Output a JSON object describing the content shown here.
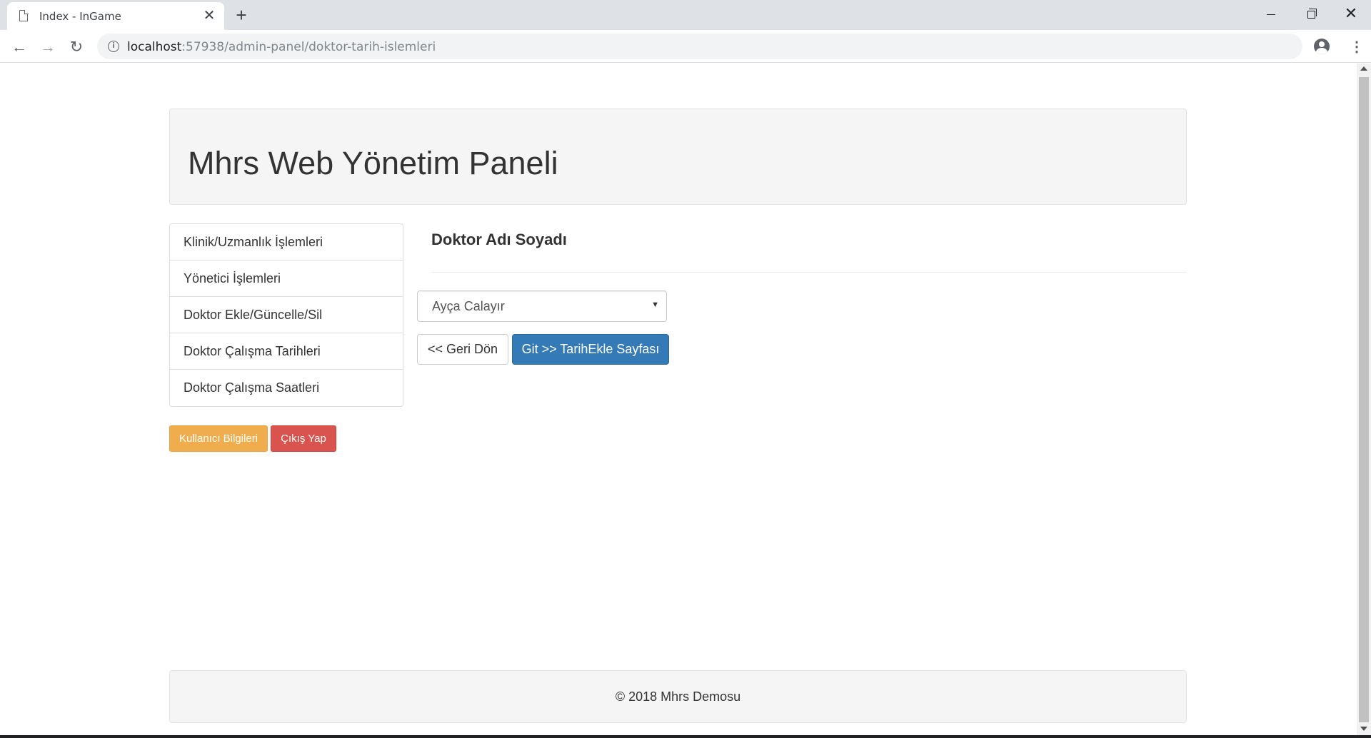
{
  "browser": {
    "tab_title": "Index - InGame",
    "tab_close": "✕",
    "new_tab": "+",
    "url_host": "localhost",
    "url_path": ":57938/admin-panel/doktor-tarih-islemleri",
    "info_glyph": "i",
    "icons": [
      "doc-icon",
      "close-icon",
      "plus-icon",
      "back-icon",
      "forward-icon",
      "reload-icon",
      "info-icon",
      "star-icon",
      "account-icon",
      "menu-icon"
    ]
  },
  "header": {
    "title": "Mhrs Web Yönetim Paneli"
  },
  "sidebar": {
    "items": [
      {
        "label": "Klinik/Uzmanlık İşlemleri"
      },
      {
        "label": "Yönetici İşlemleri"
      },
      {
        "label": "Doktor Ekle/Güncelle/Sil"
      },
      {
        "label": "Doktor Çalışma Tarihleri"
      },
      {
        "label": "Doktor Çalışma Saatleri"
      }
    ],
    "user_info_button": "Kullanıcı Bilgileri",
    "logout_button": "Çıkış Yap"
  },
  "main": {
    "section_title": "Doktor Adı Soyadı",
    "doctor_select_value": "Ayça Calayır",
    "back_button": "<< Geri Dön",
    "go_button": "Git >> TarihEkle Sayfası"
  },
  "footer": {
    "text": "© 2018 Mhrs Demosu"
  },
  "colors": {
    "primary": "#337ab7",
    "warning": "#f0ad4e",
    "danger": "#d9534f",
    "panel_bg": "#f5f5f5"
  }
}
